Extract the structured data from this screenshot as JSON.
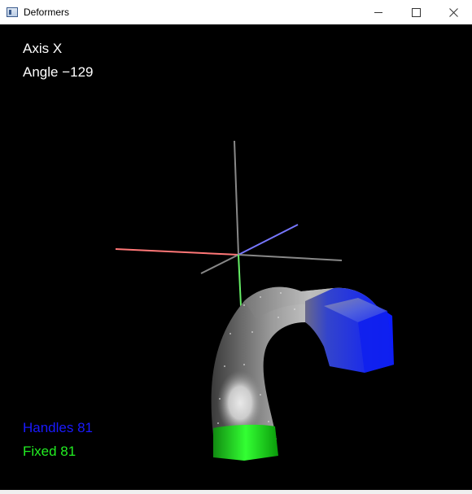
{
  "window": {
    "title": "Deformers",
    "icon": "app-window-icon",
    "controls": [
      "minimize-icon",
      "maximize-icon",
      "close-icon"
    ]
  },
  "hud": {
    "axis": "Axis X",
    "angle": "Angle −129",
    "handles": "Handles 81",
    "fixed": "Fixed 81"
  },
  "colors": {
    "background": "#000000",
    "handles": "#1a1aff",
    "fixed": "#22ee22",
    "axis_x": "#ff7777",
    "axis_y": "#66ee66",
    "axis_z": "#7777ff",
    "axis_neutral": "#888888"
  }
}
